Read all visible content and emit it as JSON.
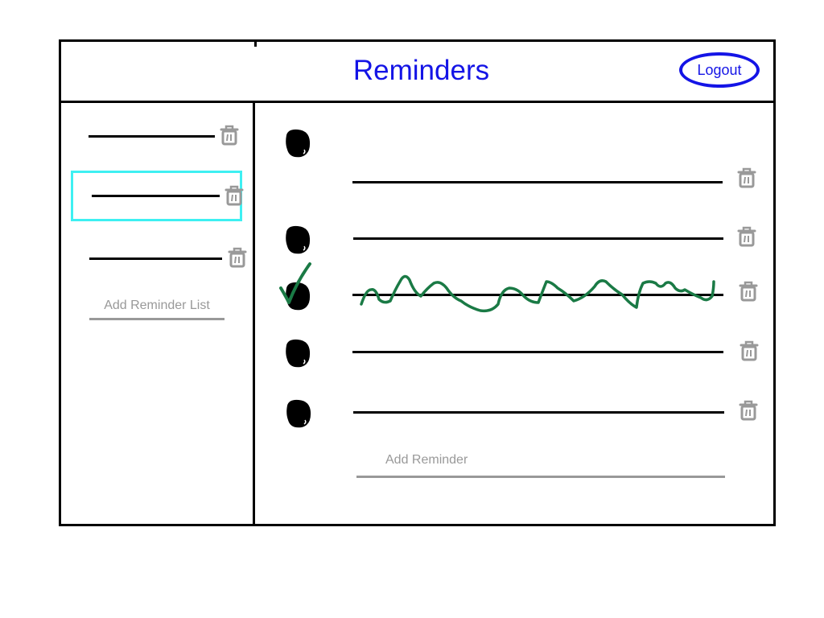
{
  "header": {
    "title": "Reminders",
    "logout_label": "Logout"
  },
  "sidebar": {
    "lists": [
      {
        "selected": false
      },
      {
        "selected": true
      },
      {
        "selected": false
      }
    ],
    "add_list_label": "Add Reminder List"
  },
  "main": {
    "reminders": [
      {
        "completed": false
      },
      {
        "completed": false
      },
      {
        "completed": true
      },
      {
        "completed": false
      },
      {
        "completed": false
      }
    ],
    "add_reminder_label": "Add Reminder"
  },
  "colors": {
    "title": "#1414e6",
    "selection": "#3ef0f2",
    "completed_mark": "#1a7a45",
    "muted": "#999999"
  },
  "icons": {
    "delete": "trash-icon",
    "bullet": "bullet-icon",
    "done": "checkmark-icon"
  }
}
